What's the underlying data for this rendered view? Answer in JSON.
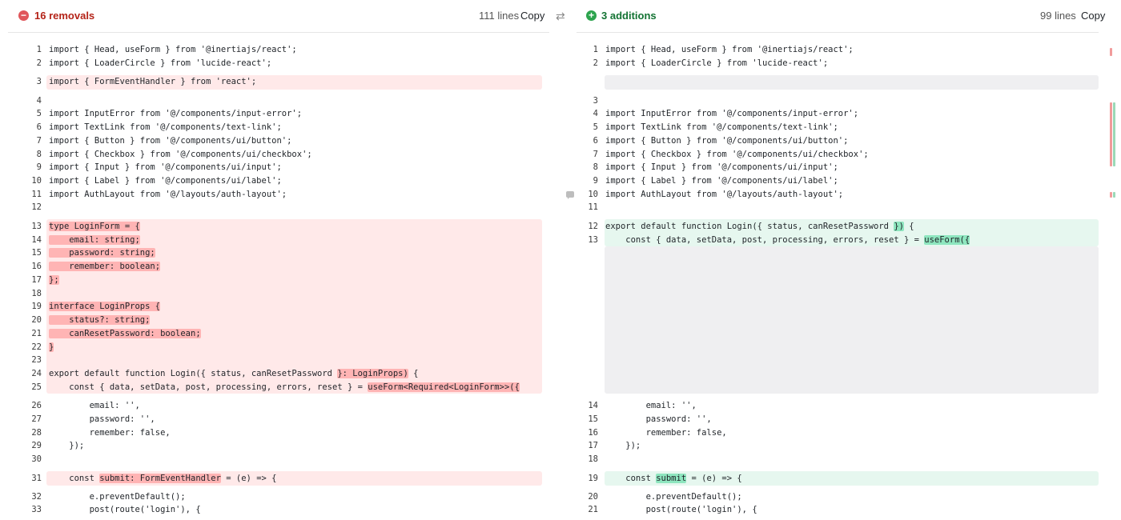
{
  "diff": {
    "left": {
      "summary_label": "16 removals",
      "lines_label": "111 lines",
      "copy_label": "Copy",
      "lines": [
        {
          "num": "1",
          "text": "import { Head, useForm } from '@inertiajs/react';",
          "kind": "normal"
        },
        {
          "num": "2",
          "text": "import { LoaderCircle } from 'lucide-react';",
          "kind": "normal"
        },
        {
          "num": "3",
          "text": "import { FormEventHandler } from 'react';",
          "kind": "removed"
        },
        {
          "num": "4",
          "text": "",
          "kind": "normal"
        },
        {
          "num": "5",
          "text": "import InputError from '@/components/input-error';",
          "kind": "normal"
        },
        {
          "num": "6",
          "text": "import TextLink from '@/components/text-link';",
          "kind": "normal"
        },
        {
          "num": "7",
          "text": "import { Button } from '@/components/ui/button';",
          "kind": "normal"
        },
        {
          "num": "8",
          "text": "import { Checkbox } from '@/components/ui/checkbox';",
          "kind": "normal"
        },
        {
          "num": "9",
          "text": "import { Input } from '@/components/ui/input';",
          "kind": "normal"
        },
        {
          "num": "10",
          "text": "import { Label } from '@/components/ui/label';",
          "kind": "normal"
        },
        {
          "num": "11",
          "text": "import AuthLayout from '@/layouts/auth-layout';",
          "kind": "normal"
        },
        {
          "num": "12",
          "text": "",
          "kind": "normal"
        },
        {
          "num": "13",
          "text": "type LoginForm = {",
          "kind": "removed"
        },
        {
          "num": "14",
          "text": "    email: string;",
          "kind": "removed"
        },
        {
          "num": "15",
          "text": "    password: string;",
          "kind": "removed"
        },
        {
          "num": "16",
          "text": "    remember: boolean;",
          "kind": "removed"
        },
        {
          "num": "17",
          "text": "};",
          "kind": "removed"
        },
        {
          "num": "18",
          "text": "",
          "kind": "removed"
        },
        {
          "num": "19",
          "text": "interface LoginProps {",
          "kind": "removed"
        },
        {
          "num": "20",
          "text": "    status?: string;",
          "kind": "removed"
        },
        {
          "num": "21",
          "text": "    canResetPassword: boolean;",
          "kind": "removed"
        },
        {
          "num": "22",
          "text": "}",
          "kind": "removed"
        },
        {
          "num": "23",
          "text": "",
          "kind": "removed"
        },
        {
          "num": "24",
          "text": "export default function Login({ status, canResetPassword }: LoginProps) {",
          "kind": "removed"
        },
        {
          "num": "25",
          "text": "    const { data, setData, post, processing, errors, reset } = useForm<Required<LoginForm>>({",
          "kind": "removed"
        },
        {
          "num": "26",
          "text": "        email: '',",
          "kind": "normal"
        },
        {
          "num": "27",
          "text": "        password: '',",
          "kind": "normal"
        },
        {
          "num": "28",
          "text": "        remember: false,",
          "kind": "normal"
        },
        {
          "num": "29",
          "text": "    });",
          "kind": "normal"
        },
        {
          "num": "30",
          "text": "",
          "kind": "normal"
        },
        {
          "num": "31",
          "text": "    const submit: FormEventHandler = (e) => {",
          "kind": "removed"
        },
        {
          "num": "32",
          "text": "        e.preventDefault();",
          "kind": "normal"
        },
        {
          "num": "33",
          "text": "        post(route('login'), {",
          "kind": "normal"
        }
      ]
    },
    "right": {
      "summary_label": "3 additions",
      "lines_label": "99 lines",
      "copy_label": "Copy",
      "lines": [
        {
          "num": "1",
          "text": "import { Head, useForm } from '@inertiajs/react';",
          "kind": "normal"
        },
        {
          "num": "2",
          "text": "import { LoaderCircle } from 'lucide-react';",
          "kind": "normal"
        },
        {
          "num": "3",
          "text": "",
          "kind": "normal"
        },
        {
          "num": "4",
          "text": "import InputError from '@/components/input-error';",
          "kind": "normal"
        },
        {
          "num": "5",
          "text": "import TextLink from '@/components/text-link';",
          "kind": "normal"
        },
        {
          "num": "6",
          "text": "import { Button } from '@/components/ui/button';",
          "kind": "normal"
        },
        {
          "num": "7",
          "text": "import { Checkbox } from '@/components/ui/checkbox';",
          "kind": "normal"
        },
        {
          "num": "8",
          "text": "import { Input } from '@/components/ui/input';",
          "kind": "normal"
        },
        {
          "num": "9",
          "text": "import { Label } from '@/components/ui/label';",
          "kind": "normal"
        },
        {
          "num": "10",
          "text": "import AuthLayout from '@/layouts/auth-layout';",
          "kind": "normal"
        },
        {
          "num": "11",
          "text": "",
          "kind": "normal"
        },
        {
          "num": "12",
          "text": "export default function Login({ status, canResetPassword }) {",
          "kind": "added"
        },
        {
          "num": "13",
          "text": "    const { data, setData, post, processing, errors, reset } = useForm({",
          "kind": "added"
        },
        {
          "num": "14",
          "text": "        email: '',",
          "kind": "normal"
        },
        {
          "num": "15",
          "text": "        password: '',",
          "kind": "normal"
        },
        {
          "num": "16",
          "text": "        remember: false,",
          "kind": "normal"
        },
        {
          "num": "17",
          "text": "    });",
          "kind": "normal"
        },
        {
          "num": "18",
          "text": "",
          "kind": "normal"
        },
        {
          "num": "19",
          "text": "    const submit = (e) => {",
          "kind": "added"
        },
        {
          "num": "20",
          "text": "        e.preventDefault();",
          "kind": "normal"
        },
        {
          "num": "21",
          "text": "        post(route('login'), {",
          "kind": "normal"
        }
      ]
    }
  },
  "colors": {
    "removed_bg": "#ffe9e9",
    "removed_highlight": "#ffb4b4",
    "added_bg": "#e6f7ef",
    "added_highlight": "#8ee6bf",
    "empty_bg": "#efeff1"
  },
  "icons": [
    "minus-circle-icon",
    "plus-circle-icon",
    "swap-arrows-icon",
    "comment-icon"
  ]
}
